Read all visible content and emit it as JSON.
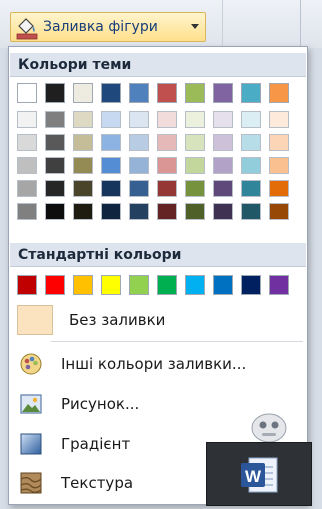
{
  "ribbon": {
    "shape_fill_label": "Заливка фігури",
    "icons": {
      "fill": "paint-bucket-icon",
      "dropdown": "chevron-down-icon"
    }
  },
  "menu": {
    "theme_colors_heading": "Кольори теми",
    "standard_colors_heading": "Стандартні кольори",
    "theme_colors": [
      {
        "base": "#ffffff",
        "shades": [
          "#f2f2f2",
          "#d9d9d9",
          "#bfbfbf",
          "#a6a6a6",
          "#808080"
        ]
      },
      {
        "base": "#1f1f1f",
        "shades": [
          "#7f7f7f",
          "#595959",
          "#404040",
          "#262626",
          "#0d0d0d"
        ]
      },
      {
        "base": "#eeece1",
        "shades": [
          "#ddd9c3",
          "#c4bd97",
          "#948a54",
          "#4a452a",
          "#1e1c11"
        ]
      },
      {
        "base": "#1f497d",
        "shades": [
          "#c6d9f0",
          "#8db3e2",
          "#548dd4",
          "#17365d",
          "#0f243e"
        ]
      },
      {
        "base": "#4f81bd",
        "shades": [
          "#dbe5f1",
          "#b8cce4",
          "#95b3d7",
          "#366092",
          "#244061"
        ]
      },
      {
        "base": "#c0504d",
        "shades": [
          "#f2dcdb",
          "#e5b9b7",
          "#d99694",
          "#953734",
          "#632423"
        ]
      },
      {
        "base": "#9bbb59",
        "shades": [
          "#ebf1dd",
          "#d7e3bc",
          "#c3d69b",
          "#76923c",
          "#4f6128"
        ]
      },
      {
        "base": "#8064a2",
        "shades": [
          "#e5e0ec",
          "#ccc1d9",
          "#b2a2c7",
          "#5f497a",
          "#3f3151"
        ]
      },
      {
        "base": "#4bacc6",
        "shades": [
          "#dbeef3",
          "#b7dde8",
          "#92cddc",
          "#31859b",
          "#205867"
        ]
      },
      {
        "base": "#f79646",
        "shades": [
          "#fdeada",
          "#fbd5b5",
          "#fac08f",
          "#e36c09",
          "#974806"
        ]
      }
    ],
    "standard_colors": [
      "#c00000",
      "#ff0000",
      "#ffc000",
      "#ffff00",
      "#92d050",
      "#00b050",
      "#00b0f0",
      "#0070c0",
      "#002060",
      "#7030a0"
    ],
    "no_fill_label": "Без заливки",
    "more_fill_colors_label": "Інші кольори заливки...",
    "picture_label": "Рисунок...",
    "gradient_label": "Градієнт",
    "texture_label": "Текстура",
    "icons": {
      "more_colors": "color-palette-icon",
      "picture": "picture-icon",
      "gradient": "gradient-icon",
      "texture": "texture-icon",
      "app": "word-icon"
    },
    "app_letter": "W"
  }
}
